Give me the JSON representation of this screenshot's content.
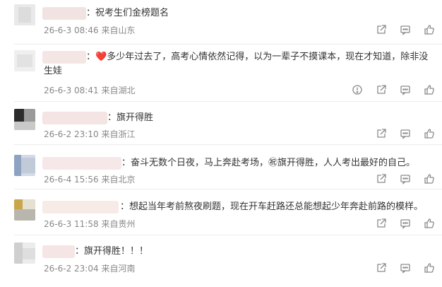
{
  "comments": [
    {
      "text": "：祝考生们金榜题名",
      "time": "26-6-3 08:46",
      "location": "来自山东",
      "actions": [
        "share-icon",
        "comment-icon",
        "like-icon"
      ]
    },
    {
      "text_prefix": "：",
      "heart": "❤️",
      "text_line1": "多少年过去了，高考心情依然记得，以为一辈子不摸课本，现在才知道，除非没",
      "text_line2": "生娃",
      "time": "26-6-3 08:41",
      "location": "来自湖北",
      "actions": [
        "report-icon",
        "share-icon",
        "comment-icon",
        "like-icon"
      ]
    },
    {
      "text": "：旗开得胜",
      "time": "26-6-2 23:10",
      "location": "来自浙江",
      "actions": [
        "share-icon",
        "comment-icon",
        "like-icon"
      ]
    },
    {
      "text": "：奋斗无数个日夜，马上奔赴考场，㊗旗开得胜，人人考出最好的自己。",
      "time": "26-6-4 15:56",
      "location": "来自北京",
      "actions": [
        "share-icon",
        "comment-icon",
        "like-icon"
      ]
    },
    {
      "text": "：想起当年考前熬夜刷题，现在开车赶路还总能想起少年奔赴前路的模样。",
      "time": "26-6-3 11:58",
      "location": "来自贵州",
      "actions": [
        "share-icon",
        "comment-icon",
        "like-icon"
      ]
    },
    {
      "text": "：旗开得胜！！！",
      "time": "26-6-2 23:04",
      "location": "来自河南",
      "actions": [
        "share-icon",
        "comment-icon",
        "like-icon"
      ]
    }
  ]
}
